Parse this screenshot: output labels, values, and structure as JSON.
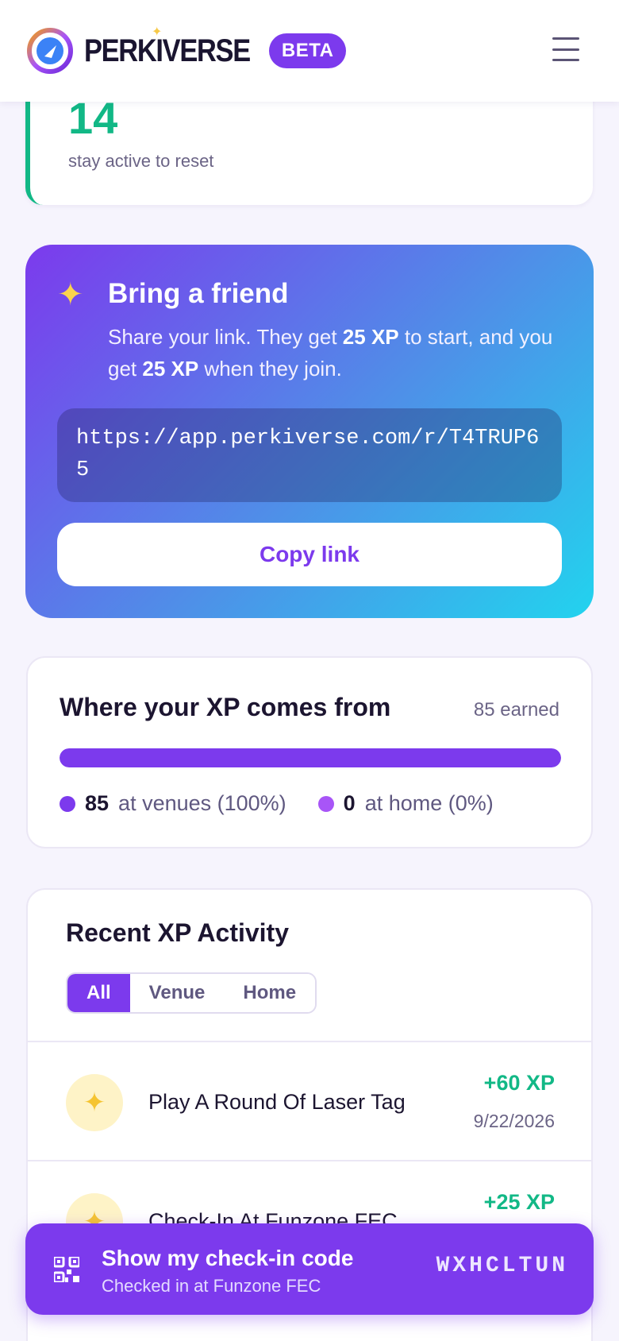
{
  "header": {
    "brand": "PERKIVERSE",
    "badge": "BETA"
  },
  "streak": {
    "value": "14",
    "note": "stay active to reset"
  },
  "referral": {
    "title": "Bring a friend",
    "desc_pre": "Share your link. They get ",
    "desc_xp1": "25 XP",
    "desc_mid": " to start, and you get ",
    "desc_xp2": "25 XP",
    "desc_post": " when they join.",
    "link": "https://app.perkiverse.com/r/T4TRUP65",
    "copy_label": "Copy link"
  },
  "xp_sources": {
    "title": "Where your XP comes from",
    "earned": "85 earned",
    "venue_fraction": 1.0,
    "legend": [
      {
        "value": "85",
        "label": "at venues (100%)",
        "color": "#7c3aed"
      },
      {
        "value": "0",
        "label": "at home (0%)",
        "color": "#a855f7"
      }
    ]
  },
  "activity": {
    "title": "Recent XP Activity",
    "tabs": [
      "All",
      "Venue",
      "Home"
    ],
    "active_tab": "All",
    "items": [
      {
        "label": "Play A Round Of Laser Tag",
        "xp": "+60 XP",
        "date": "9/22/2026",
        "icon": "sparkle-icon"
      },
      {
        "label": "Check-In At Funzone FEC",
        "xp": "+25 XP",
        "date": "",
        "icon": "sparkle-icon"
      }
    ]
  },
  "checkin": {
    "title": "Show my check-in code",
    "subtitle": "Checked in at Funzone FEC",
    "code": "WXHCLTUN"
  }
}
